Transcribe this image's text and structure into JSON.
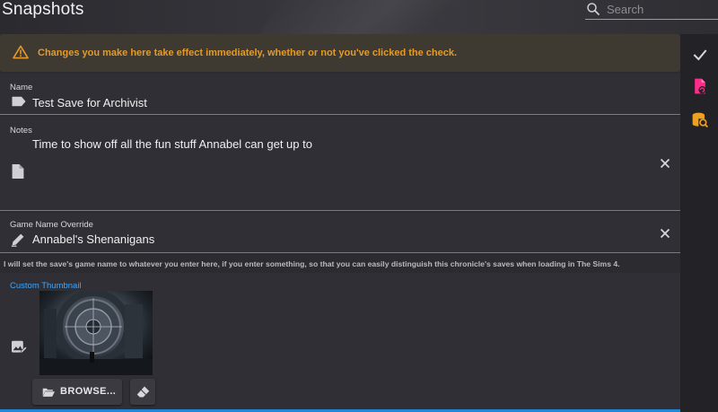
{
  "header": {
    "title": "Snapshots",
    "search_placeholder": "Search",
    "search_value": ""
  },
  "alert": {
    "text": "Changes you make here take effect immediately, whether or not you've clicked the check.",
    "color": "#e39a2a",
    "icon": "warning-icon"
  },
  "form": {
    "name": {
      "label": "Name",
      "value": "Test Save for Archivist",
      "icon": "label-tag-icon"
    },
    "notes": {
      "label": "Notes",
      "value": "Time to show off all the fun stuff Annabel can get up to",
      "icon": "note-icon",
      "clear_icon": "close-icon"
    },
    "game_name_override": {
      "label": "Game Name Override",
      "value": "Annabel's Shenanigans",
      "icon": "pencil-icon",
      "clear_icon": "close-icon"
    },
    "game_name_hint": "I will set the save's game name to whatever you enter here, if you enter something, so that you can easily distinguish this chronicle's saves when loading in The Sims 4.",
    "custom_thumbnail": {
      "label": "Custom Thumbnail",
      "icon": "image-edit-icon",
      "browse_label": "BROWSE...",
      "browse_icon": "folder-open-icon",
      "clear_icon": "eraser-icon"
    }
  },
  "right_rail": {
    "icons": [
      "check-icon",
      "file-refresh-icon",
      "database-search-icon"
    ]
  },
  "colors": {
    "accent_blue": "#3ea6ff",
    "accent_pink": "#ff2d8a",
    "accent_orange": "#f0a020",
    "background": "#2b2b30"
  }
}
